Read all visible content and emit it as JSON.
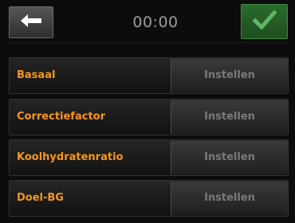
{
  "header": {
    "time": "00:00",
    "back_icon": "arrow-left-icon",
    "confirm_icon": "checkmark-icon"
  },
  "menu": {
    "items": [
      {
        "label": "Basaal",
        "action": "Instellen"
      },
      {
        "label": "Correctiefactor",
        "action": "Instellen"
      },
      {
        "label": "Koolhydratenratio",
        "action": "Instellen"
      },
      {
        "label": "Doel-BG",
        "action": "Instellen"
      }
    ]
  },
  "colors": {
    "label": "#f7961c",
    "action_text": "#7a7a7a",
    "confirm_bg": "#2a6b2c",
    "background": "#0c0c0c"
  }
}
